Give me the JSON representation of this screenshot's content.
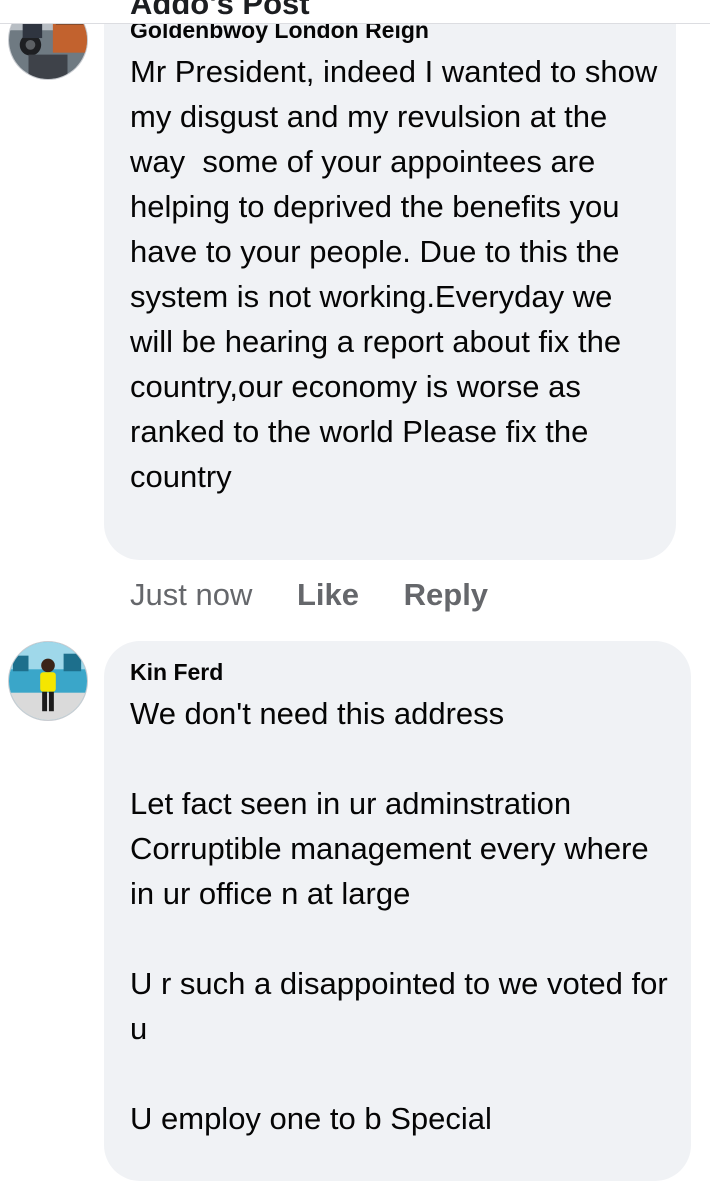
{
  "header": {
    "title": "Addo's Post"
  },
  "comments": [
    {
      "author": "Goldenbwoy London Reign",
      "avatar_icon": "profile-photo-motorbike",
      "text": "Mr President, indeed I wanted to show my disgust and my revulsion at the way  some of your appointees are helping to deprived the benefits you have to your people. Due to this the system is not working.Everyday we will be hearing a report about fix the country,our economy is worse as ranked to the world Please fix the country",
      "time": "Just now",
      "like_label": "Like",
      "reply_label": "Reply"
    },
    {
      "author": "Kin Ferd",
      "avatar_icon": "profile-photo-person-yellow-shirt",
      "text": "We don't need this address\n\nLet fact seen in ur adminstration\nCorruptible management every where in ur office n at large\n\nU r such a disappointed to we voted for u\n\nU employ one to b Special"
    }
  ],
  "colors": {
    "bubble_background": "#f0f2f5",
    "secondary_text": "#65676b",
    "primary_text": "#050505"
  }
}
